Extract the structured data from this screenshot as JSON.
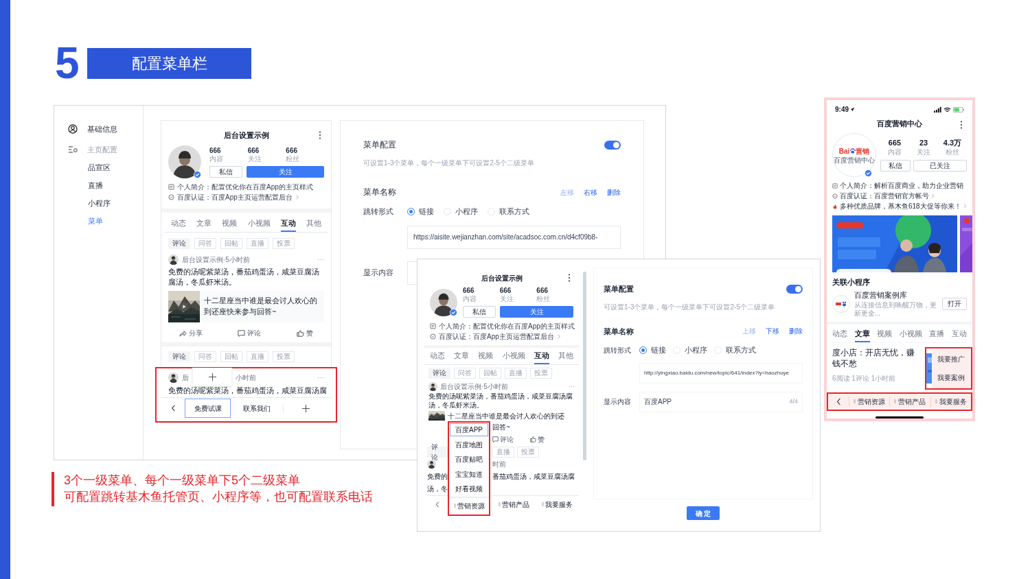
{
  "slide": {
    "number": "5",
    "title": "配置菜单栏"
  },
  "editor": {
    "sidebar": [
      {
        "label": "基础信息",
        "selected": false
      },
      {
        "label": "主页配置",
        "selected": false,
        "children": [
          {
            "label": "品宣区",
            "selected": false
          },
          {
            "label": "直播",
            "selected": false
          },
          {
            "label": "小程序",
            "selected": false
          },
          {
            "label": "菜单",
            "selected": true
          }
        ]
      }
    ],
    "preview": {
      "title": "后台设置示例",
      "stats": [
        {
          "value": "666",
          "label": "内容"
        },
        {
          "value": "666",
          "label": "关注"
        },
        {
          "value": "666",
          "label": "粉丝"
        }
      ],
      "buttons": [
        {
          "label": "私信",
          "primary": false
        },
        {
          "label": "关注",
          "primary": true
        }
      ],
      "info": [
        {
          "kind": "intro",
          "text": "个人简介：配置优化你在百度App的主页样式"
        },
        {
          "kind": "cert",
          "text": "百度认证：百度App主页运营配置后台"
        }
      ],
      "tabs": [
        {
          "label": "动态",
          "selected": false
        },
        {
          "label": "文章",
          "selected": false
        },
        {
          "label": "视频",
          "selected": false
        },
        {
          "label": "小视频",
          "selected": false
        },
        {
          "label": "互动",
          "selected": true
        },
        {
          "label": "其他",
          "selected": false
        }
      ],
      "filters": [
        {
          "label": "评论",
          "selected": true
        },
        {
          "label": "问答",
          "selected": false
        },
        {
          "label": "回帖",
          "selected": false
        },
        {
          "label": "直播",
          "selected": false
        },
        {
          "label": "投票",
          "selected": false
        }
      ],
      "post": {
        "author": "后台设置示例·5小时前",
        "text": "免费的汤呢紫菜汤，番茄鸡蛋汤，咸菜豆腐汤腐汤，冬瓜虾米汤。",
        "link": "十二星座当中谁是最会讨人欢心的到还座快来参与回答~",
        "actions": [
          "分享",
          "评论",
          "赞"
        ]
      },
      "filters_2": [
        {
          "label": "评论",
          "selected": true
        },
        {
          "label": "问答",
          "selected": false
        },
        {
          "label": "回帖",
          "selected": false
        },
        {
          "label": "直播",
          "selected": false
        },
        {
          "label": "投票",
          "selected": false
        }
      ],
      "post_2": {
        "author_head": "后",
        "author_tail": "小时前",
        "text": "免费的汤呢紫菜汤，番茄鸡蛋汤，咸菜豆腐汤腐"
      },
      "menu": [
        {
          "kind": "back"
        },
        {
          "kind": "item",
          "label": "免费试课",
          "selected": true
        },
        {
          "kind": "item",
          "label": "联系我们",
          "selected": false
        },
        {
          "kind": "add"
        }
      ]
    },
    "config": {
      "title": "菜单配置",
      "enabled": true,
      "hint": "可设置1-3个菜单，每个一级菜单下可设置2-5个二级菜单",
      "name_label": "菜单名称",
      "actions": [
        {
          "label": "左移",
          "disabled": true
        },
        {
          "label": "右移",
          "disabled": false
        },
        {
          "label": "删除",
          "disabled": false
        }
      ],
      "jump_label": "跳转形式",
      "jump_options": [
        {
          "label": "链接",
          "selected": true
        },
        {
          "label": "小程序",
          "selected": false
        },
        {
          "label": "联系方式",
          "selected": false
        }
      ],
      "url": "https://aisite.wejianzhan.com/site/acadsoc.com.cn/d4cf09b8-",
      "content_label": "显示内容"
    }
  },
  "example": {
    "preview": {
      "title": "后台设置示例",
      "stats": [
        {
          "value": "666",
          "label": "内容"
        },
        {
          "value": "666",
          "label": "关注"
        },
        {
          "value": "666",
          "label": "粉丝"
        }
      ],
      "buttons": [
        {
          "label": "私信",
          "primary": false
        },
        {
          "label": "关注",
          "primary": true
        }
      ],
      "info": [
        {
          "kind": "intro",
          "text": "个人简介：配置优化你在百度App的主页样式"
        },
        {
          "kind": "cert",
          "text": "百度认证：百度App主页运营配置后台"
        }
      ],
      "tabs": [
        {
          "label": "动态",
          "selected": false
        },
        {
          "label": "文章",
          "selected": false
        },
        {
          "label": "视频",
          "selected": false
        },
        {
          "label": "小视频",
          "selected": false
        },
        {
          "label": "互动",
          "selected": true
        },
        {
          "label": "其他",
          "selected": false
        }
      ],
      "filters": [
        {
          "label": "评论",
          "selected": true
        },
        {
          "label": "问答",
          "selected": false
        },
        {
          "label": "回帖",
          "selected": false
        },
        {
          "label": "直播",
          "selected": false
        },
        {
          "label": "投票",
          "selected": false
        }
      ],
      "post_author": "后台设置示例·5小时前",
      "post_text": "免费的汤呢紫菜汤，番茄鸡蛋汤，咸菜豆腐汤腐汤，冬瓜虾米汤。",
      "link_line": "十二星座当中谁是最会讨人欢心的到还",
      "link_tail": "回答~",
      "actions": [
        "评论",
        "赞"
      ],
      "filters_2_left": [
        {
          "label": "评论",
          "selected": true
        }
      ],
      "filters_2_right": [
        {
          "label": "直播",
          "selected": false
        },
        {
          "label": "投票",
          "selected": false
        }
      ],
      "post_2_author_tail": "时前",
      "post_2_text_left": [
        "免费的",
        "汤，冬"
      ],
      "post_2_text_right": "番茄鸡蛋汤，咸菜豆腐汤腐",
      "menu": [
        {
          "kind": "back"
        },
        {
          "kind": "item",
          "label": "营销资源"
        },
        {
          "kind": "item",
          "label": "营销产品"
        },
        {
          "kind": "item",
          "label": "我要服务"
        }
      ]
    },
    "popup_items": [
      {
        "label": "百度APP",
        "selected": true
      },
      {
        "label": "百度地图",
        "selected": false
      },
      {
        "label": "百度贴吧",
        "selected": false
      },
      {
        "label": "宝宝知道",
        "selected": false
      },
      {
        "label": "好看视频",
        "selected": false
      }
    ],
    "config": {
      "title": "菜单配置",
      "enabled": true,
      "hint": "可设置1-3个菜单，每个一级菜单下可设置2-5个二级菜单",
      "name_label": "菜单名称",
      "actions": [
        {
          "label": "上移",
          "disabled": true
        },
        {
          "label": "下移",
          "disabled": false
        },
        {
          "label": "删除",
          "disabled": false
        }
      ],
      "jump_label": "跳转形式",
      "jump_options": [
        {
          "label": "链接",
          "selected": true
        },
        {
          "label": "小程序",
          "selected": false
        },
        {
          "label": "联系方式",
          "selected": false
        }
      ],
      "url": "http://yingxiao.baidu.com/new/topic/641/index?ly=haozhuye",
      "content_label": "显示内容",
      "content": "百度APP",
      "counter": "4/4"
    },
    "confirm": "确 定"
  },
  "phone": {
    "time": "9:49",
    "title": "百度营销中心",
    "logo": {
      "text": "Bai",
      "brand": "营销",
      "caption": "百度营销中心"
    },
    "stats": [
      {
        "value": "665",
        "label": "内容"
      },
      {
        "value": "23",
        "label": "关注"
      },
      {
        "value": "4.3万",
        "label": "粉丝"
      }
    ],
    "buttons": [
      {
        "label": "私信",
        "primary": false
      },
      {
        "label": "已关注",
        "primary": false
      }
    ],
    "info": [
      {
        "kind": "intro",
        "text": "个人简介：解析百度商业，助力企业营销"
      },
      {
        "kind": "cert",
        "text": "百度认证：百度营销官方帐号"
      },
      {
        "kind": "promo",
        "text": "多种优质品牌，基木鱼618大促等你来！"
      }
    ],
    "mini_heading": "关联小程序",
    "mini_program": {
      "name": "百度营销案例库",
      "desc": "从连接信息到唤醒万物，更新更全...",
      "button": "打开"
    },
    "tabs": [
      {
        "label": "动态",
        "selected": false
      },
      {
        "label": "文章",
        "selected": true
      },
      {
        "label": "视频",
        "selected": false
      },
      {
        "label": "小视频",
        "selected": false
      },
      {
        "label": "直播",
        "selected": false
      },
      {
        "label": "互动",
        "selected": false
      }
    ],
    "article": {
      "title": "度小店：开店无忧，赚钱不愁",
      "meta": "6阅读 1评论 1小时前"
    },
    "popup_items": [
      "我要推广",
      "我要案例"
    ],
    "menu": [
      {
        "kind": "back"
      },
      {
        "kind": "item",
        "label": "营销资源"
      },
      {
        "kind": "item",
        "label": "营销产品"
      },
      {
        "kind": "item",
        "label": "我要服务"
      }
    ]
  },
  "note": {
    "lines": [
      "3个一级菜单、每个一级菜单下5个二级菜单",
      "可配置跳转基木鱼托管页、小程序等，也可配置联系电话"
    ]
  }
}
